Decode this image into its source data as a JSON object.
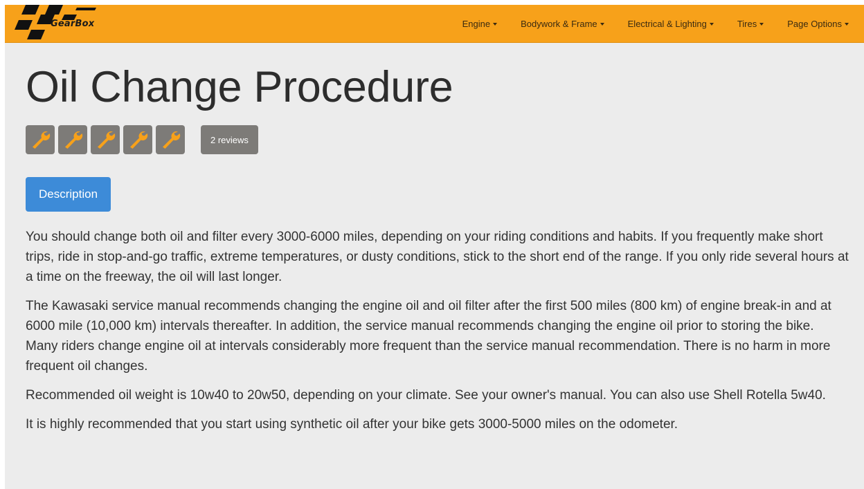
{
  "brand": {
    "name": "GearBox"
  },
  "nav": {
    "items": [
      {
        "label": "Engine"
      },
      {
        "label": "Bodywork & Frame"
      },
      {
        "label": "Electrical & Lighting"
      },
      {
        "label": "Tires"
      },
      {
        "label": "Page Options"
      }
    ]
  },
  "article": {
    "title": "Oil Change Procedure",
    "rating": {
      "value": 5,
      "max": 5,
      "icon": "wrench-icon"
    },
    "reviews_label": "2 reviews",
    "tab_label": "Description",
    "paragraphs": [
      "You should change both oil and filter every 3000-6000 miles, depending on your riding conditions and habits. If you frequently make short trips, ride in stop-and-go traffic, extreme temperatures, or dusty conditions, stick to the short end of the range. If you only ride several hours at a time on the freeway, the oil will last longer.",
      "The Kawasaki service manual recommends changing the engine oil and oil filter after the first 500 miles (800 km) of engine break-in and at 6000 mile (10,000 km) intervals thereafter. In addition, the service manual recommends changing the engine oil prior to storing the bike. Many riders change engine oil at intervals considerably more frequent than the service manual recommendation. There is no harm in more frequent oil changes.",
      "Recommended oil weight is 10w40 to 20w50, depending on your climate. See your owner's manual. You can also use Shell Rotella 5w40.",
      "It is highly recommended that you start using synthetic oil after your bike gets 3000-5000 miles on the odometer."
    ]
  },
  "colors": {
    "navbar": "#f7a11a",
    "accent_button": "#3d8bd8",
    "badge": "#7d7b78",
    "wrench": "#f7a11a",
    "page_background": "#ececec"
  }
}
